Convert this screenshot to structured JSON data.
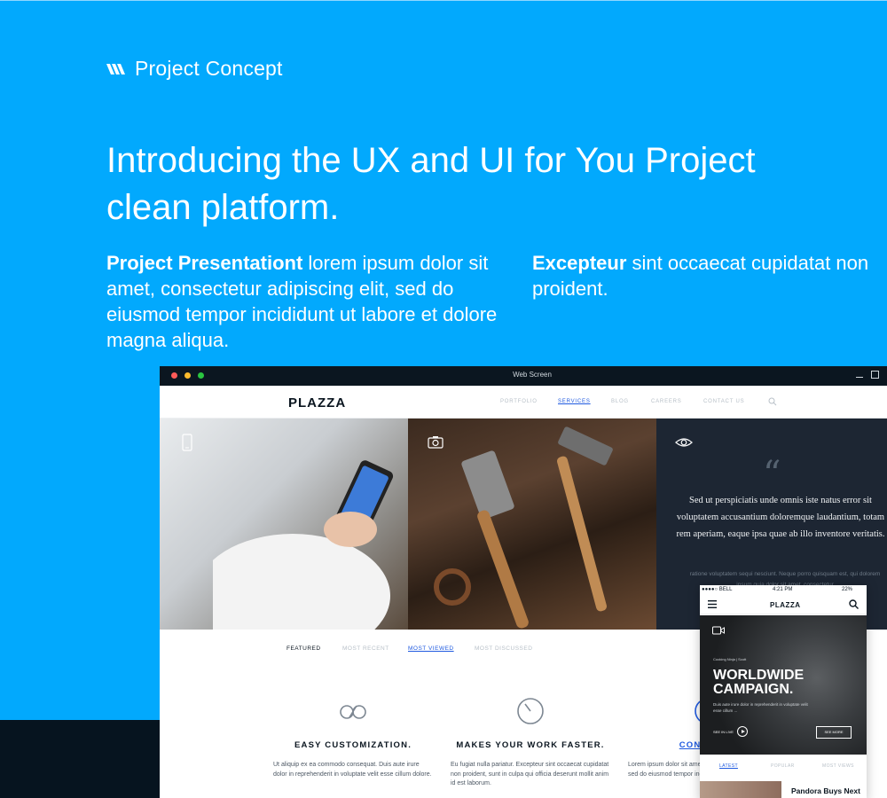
{
  "brand": {
    "name": "Project Concept",
    "logo_icon": "brand-logo-icon"
  },
  "headline": "Introducing the UX and UI for You Project clean platform.",
  "paragraphs": {
    "left_bold": "Project Presentationt",
    "left_text": " lorem ipsum dolor sit amet, consectetur adipiscing elit, sed do eiusmod tempor incididunt ut labore et dolore magna aliqua.",
    "right_bold": "Excepteur",
    "right_text": " sint occaecat cupidatat non proident."
  },
  "window": {
    "title": "Web Screen",
    "logo": "PLAZZA",
    "nav": [
      "PORTFOLIO",
      "SERVICES",
      "BLOG",
      "CAREERS",
      "CONTACT US"
    ],
    "nav_active": "SERVICES",
    "quote": {
      "text": "Sed ut perspiciatis unde omnis iste natus error sit voluptatem accusantium doloremque laudantium, totam rem aperiam, eaque ipsa quae ab illo inventore veritatis.",
      "sub": "ratione voluptatem sequi nesciunt. Neque porro quisquam est, qui dolorem ipsum quia dolor sit amet, consectetur"
    },
    "tabs": [
      "FEATURED",
      "MOST RECENT",
      "MOST VIEWED",
      "MOST DISCUSSED"
    ],
    "tab_active": "MOST VIEWED",
    "features": [
      {
        "title": "EASY CUSTOMIZATION.",
        "text": "Ut aliquip ex ea commodo consequat. Duis aute irure dolor in reprehenderit in voluptate velit esse cillum dolore.",
        "icon": "infinity-bike-icon"
      },
      {
        "title": "MAKES YOUR WORK FASTER.",
        "text": "Eu fugiat nulla pariatur. Excepteur sint occaecat cupidatat non proident, sunt in culpa qui officia deserunt mollit anim id est laborum.",
        "icon": "timer-icon"
      },
      {
        "title": "CONTEMPO",
        "text": "Lorem ipsum dolor sit amet, consectetur adipiscing elit, sed do eiusmod tempor incididunt ut labore et dolore.",
        "icon": "globe-icon"
      }
    ]
  },
  "phone": {
    "carrier": "●●●●○ BELL",
    "time": "4:21 PM",
    "battery": "22%",
    "logo": "PLAZZA",
    "meta": "Cooking Ninja  |  Scott",
    "hero_title": "WORLDWIDE CAMPAIGN.",
    "hero_desc": "Duis aute irure dolor in reprehenderit in voluptate velit esse cillum ...",
    "watch_label": "SEE IN LIVE",
    "more_label": "SEE MORE",
    "tabs": [
      "LATEST",
      "POPULAR",
      "MOST VIEWS"
    ],
    "tab_active": "LATEST",
    "news_headline": "Pandora Buys Next"
  },
  "colors": {
    "background": "#02a9fd",
    "dark": "#06141f",
    "accent": "#1f5ae0"
  }
}
